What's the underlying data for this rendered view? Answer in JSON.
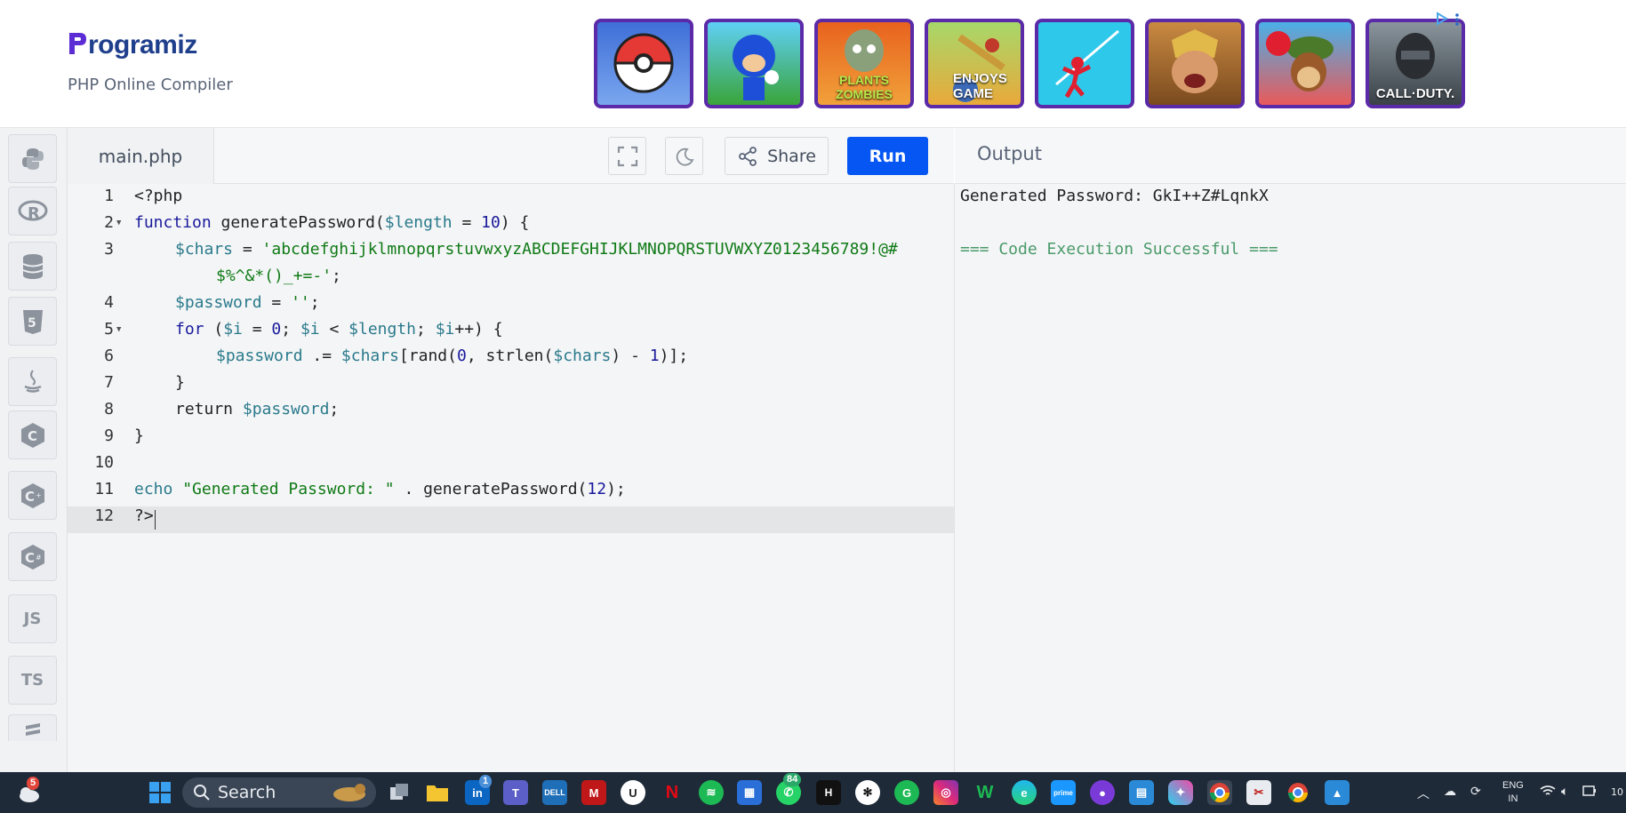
{
  "header": {
    "brand": "Programiz",
    "brand_rest": "rogramiz",
    "subtitle": "PHP Online Compiler"
  },
  "ads": {
    "tiles": [
      {
        "name": "ad-pokemon-go",
        "label": ""
      },
      {
        "name": "ad-sonic",
        "label": ""
      },
      {
        "name": "ad-plants-vs-zombies",
        "label": "PLANTS ZOMBIES"
      },
      {
        "name": "ad-enjoys-game",
        "label": "ENJOYS GAME"
      },
      {
        "name": "ad-stickman",
        "label": ""
      },
      {
        "name": "ad-lords-mobile",
        "label": ""
      },
      {
        "name": "ad-bloons",
        "label": ""
      },
      {
        "name": "ad-call-of-duty",
        "label": "CALL·DUTY."
      }
    ]
  },
  "sidebar": {
    "langs": [
      "python",
      "r",
      "sql",
      "html",
      "java",
      "c",
      "cpp",
      "csharp",
      "JS",
      "TS",
      "php"
    ]
  },
  "editor": {
    "file_name": "main.php",
    "share_label": "Share",
    "run_label": "Run",
    "line_numbers": [
      "1",
      "2",
      "3",
      "",
      "4",
      "5",
      "6",
      "7",
      "8",
      "9",
      "10",
      "11",
      "12"
    ],
    "lines": {
      "l1": "<?php",
      "l2_kw": "function",
      "l2_fn": " generatePassword(",
      "l2_var": "$length",
      "l2_op": " = ",
      "l2_num": "10",
      "l2_end": ") {",
      "l3_var": "$chars",
      "l3_op": " = ",
      "l3_str": "'abcdefghijklmnopqrstuvwxyzABCDEFGHIJKLMNOPQRSTUVWXYZ0123456789!@#",
      "l3b_str": "$%^&*()_+=-'",
      "l3b_end": ";",
      "l4_var": "$password",
      "l4_op": " = ",
      "l4_str": "''",
      "l4_end": ";",
      "l5_kw": "for",
      "l5_a": " (",
      "l5_v1": "$i",
      "l5_b": " = ",
      "l5_n0": "0",
      "l5_c": "; ",
      "l5_v2": "$i",
      "l5_d": " < ",
      "l5_v3": "$length",
      "l5_e": "; ",
      "l5_v4": "$i",
      "l5_f": "++) {",
      "l6_v1": "$password",
      "l6_a": " .= ",
      "l6_v2": "$chars",
      "l6_b": "[rand(",
      "l6_n0": "0",
      "l6_c": ", strlen(",
      "l6_v3": "$chars",
      "l6_d": ") - ",
      "l6_n1": "1",
      "l6_e": ")];",
      "l7": "}",
      "l8_kw": "return",
      "l8_sp": " ",
      "l8_var": "$password",
      "l8_end": ";",
      "l9": "}",
      "l11_kw": "echo",
      "l11_sp": " ",
      "l11_str": "\"Generated Password: \"",
      "l11_mid": " . generatePassword(",
      "l11_num": "12",
      "l11_end": ");",
      "l12": "?>"
    }
  },
  "output": {
    "title": "Output",
    "line1": "Generated Password: GkI++Z#LqnkX",
    "line2": "=== Code Execution Successful ==="
  },
  "taskbar": {
    "search_label": "Search",
    "notif_count": "5",
    "linkedin_badge": "1",
    "whatsapp_badge": "84",
    "lang_line1": "ENG",
    "lang_line2": "IN",
    "time_partial": "10"
  },
  "colors": {
    "run_button": "#0556f3",
    "brand": "#1f3f8c",
    "ad_border": "#5b2aa8",
    "string": "#0f7a16",
    "variable": "#2a7a8c",
    "keyword": "#1a1a9c"
  }
}
